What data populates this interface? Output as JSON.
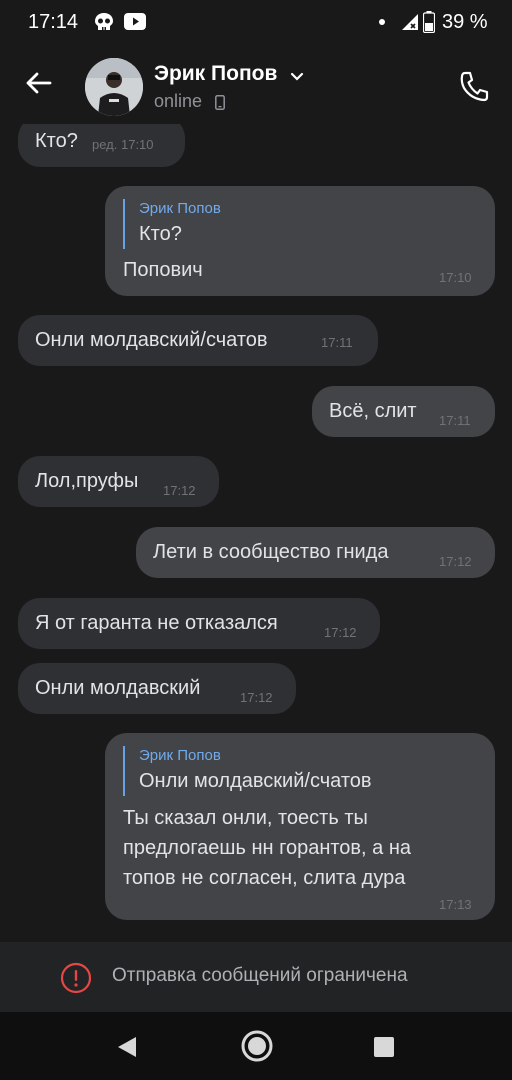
{
  "status_bar": {
    "time": "17:14",
    "battery_percent": "39 %",
    "icons": [
      "skull-icon",
      "youtube-icon",
      "notification-dot-icon",
      "signal-icon",
      "battery-icon"
    ]
  },
  "header": {
    "contact_name": "Эрик Попов",
    "presence": "online",
    "icons": [
      "back-arrow-icon",
      "chevron-down-icon",
      "mobile-phone-icon",
      "phone-call-icon"
    ]
  },
  "messages": [
    {
      "direction": "in",
      "text": "Кто?",
      "time": "ред. 17:10"
    },
    {
      "direction": "out",
      "reply_author": "Эрик Попов",
      "reply_text": "Кто?",
      "text": "Попович",
      "time": "17:10"
    },
    {
      "direction": "in",
      "text": "Онли молдавский/счатов",
      "time": "17:11"
    },
    {
      "direction": "out",
      "text": "Всё, слит",
      "time": "17:11"
    },
    {
      "direction": "in",
      "text": "Лол,пруфы",
      "time": "17:12"
    },
    {
      "direction": "out",
      "text": "Лети в сообщество гнида",
      "time": "17:12"
    },
    {
      "direction": "in",
      "text": "Я от гаранта не отказался",
      "time": "17:12"
    },
    {
      "direction": "in",
      "text": "Онли молдавский",
      "time": "17:12"
    },
    {
      "direction": "out",
      "reply_author": "Эрик Попов",
      "reply_text": "Онли молдавский/счатов",
      "text": "Ты сказал онли, тоесть ты\nпредлогаешь нн горантов, а на\nтопов не согласен, слита дура",
      "time": "17:13"
    }
  ],
  "restriction": {
    "text": "Отправка сообщений ограничена",
    "icon": "warning-circle-icon",
    "icon_color": "#e64646"
  },
  "nav_bar": {
    "icons": [
      "nav-back-icon",
      "nav-home-icon",
      "nav-recents-icon"
    ]
  },
  "colors": {
    "background": "#19191a",
    "incoming_bubble": "#2f3033",
    "outgoing_bubble": "#434447",
    "reply_accent": "#71aaeb"
  }
}
